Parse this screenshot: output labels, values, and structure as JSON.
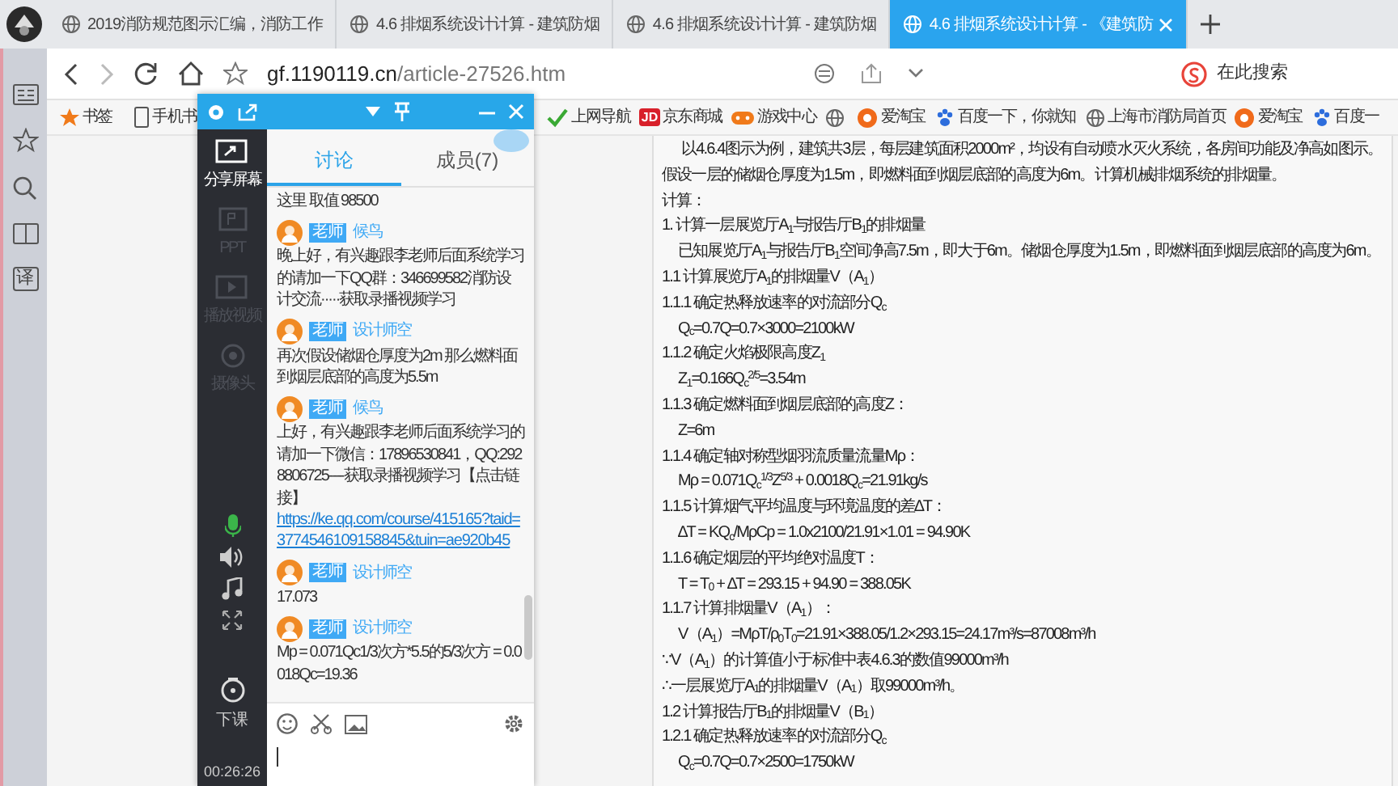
{
  "browser": {
    "tabs": [
      {
        "title": "2019消防规范图示汇编，消防工作",
        "selected": false
      },
      {
        "title": "4.6 排烟系统设计计算 - 建筑防烟",
        "selected": false
      },
      {
        "title": "4.6 排烟系统设计计算 - 建筑防烟",
        "selected": false
      },
      {
        "title": "4.6 排烟系统设计计算 - 《建筑防",
        "selected": true
      }
    ],
    "address_host": "gf.1190119.cn",
    "address_path": "/article-27526.htm",
    "search_placeholder": "在此搜索",
    "bookmarks_left": [
      {
        "label": "书签"
      },
      {
        "label": "手机书"
      }
    ],
    "bookmarks_right": [
      {
        "kind": "link",
        "label": "上网导航"
      },
      {
        "kind": "link",
        "logo_text": "JD",
        "label": "京东商城"
      },
      {
        "kind": "link",
        "label": "游戏中心"
      },
      {
        "kind": "icon"
      },
      {
        "kind": "link",
        "label": "爱淘宝"
      },
      {
        "kind": "link",
        "label": "百度一下，你就知"
      },
      {
        "kind": "link",
        "label": "上海市消防局首页"
      },
      {
        "kind": "link",
        "label": "爱淘宝"
      },
      {
        "kind": "link",
        "label": "百度一"
      }
    ],
    "side_translate": "译"
  },
  "chat": {
    "tools": [
      {
        "label": "分享屏幕",
        "disabled": false
      },
      {
        "label": "PPT",
        "disabled": true
      },
      {
        "label": "播放视频",
        "disabled": true
      },
      {
        "label": "摄像头",
        "disabled": true
      }
    ],
    "mic_on": true,
    "end_label": "下课",
    "timer": "00:26:26",
    "tabs": [
      {
        "label": "讨论",
        "selected": true
      },
      {
        "label": "成员(7)",
        "selected": false
      }
    ],
    "messages": [
      {
        "kind": "text",
        "text": "这里 取值 98500"
      },
      {
        "kind": "post",
        "role": "老师",
        "author": "候鸟",
        "text": "晚上好，有兴趣跟李老师后面系统学习的请加一下QQ群：346699582消防设计交流·····获取录播视频学习"
      },
      {
        "kind": "post",
        "role": "老师",
        "author": "设计师空",
        "text": "再次假设储烟仓厚度为2m  那么燃料面到烟层底部的高度为5.5m"
      },
      {
        "kind": "post",
        "role": "老师",
        "author": "候鸟",
        "text": "上好，有兴趣跟李老师后面系统学习的请加一下微信：17896530841，QQ:2928806725----获取录播视频学习【点击链接】",
        "link": "https://ke.qq.com/course/415165?taid=3774546109158845&tuin=ae920b45"
      },
      {
        "kind": "post",
        "role": "老师",
        "author": "设计师空",
        "text": "17.073"
      },
      {
        "kind": "post",
        "role": "老师",
        "author": "设计师空",
        "text": " Mp = 0.071Qc1/3次方*5.5的5/3次方 = 0.0018Qc=19.36"
      }
    ]
  },
  "article": {
    "lines": [
      {
        "kind": "para",
        "text": "以4.6.4图示为例，建筑共3层，每层建筑面积2000m²，均设有自动喷水灭火系统，各房间功能及净高如图示。假设一层的储烟仓厚度为1.5m，即燃料面到烟层底部的高度为6m。计算机械排烟系统的排烟量。"
      },
      {
        "kind": "plain",
        "text": "计算："
      },
      {
        "kind": "plain",
        "text": "1. 计算一层展览厅A$_{1}$与报告厅B$_{1}$的排烟量"
      },
      {
        "kind": "indent",
        "text": "已知展览厅A$_{1}$与报告厅B$_{1}$空间净高7.5m，即大于6m。储烟仓厚度为1.5m，即燃料面到烟层底部的高度为6m。"
      },
      {
        "kind": "plain",
        "text": "1.1 计算展览厅A$_{1}$的排烟量V（A$_{1}$）"
      },
      {
        "kind": "plain",
        "text": "1.1.1 确定热释放速率的对流部分Q$_{c}$"
      },
      {
        "kind": "indent",
        "text": "Q$_{c}$=0.7Q=0.7×3000=2100kW"
      },
      {
        "kind": "plain",
        "text": "1.1.2 确定火焰极限高度Z$_{1}$"
      },
      {
        "kind": "indent",
        "text": "Z$_{1}$=0.166Q$_{c}$$^{2/5}$=3.54m"
      },
      {
        "kind": "plain",
        "text": "1.1.3 确定燃料面到烟层底部的高度Z："
      },
      {
        "kind": "indent",
        "text": "Z=6m"
      },
      {
        "kind": "plain",
        "text": "1.1.4 确定轴对称型烟羽流质量流量Mρ："
      },
      {
        "kind": "indent",
        "text": "Mρ = 0.071Q$_{c}$$^{1/3}$Z$^{5/3}$ + 0.0018Q$_{c}$=21.91kg/s"
      },
      {
        "kind": "plain",
        "text": "1.1.5 计算烟气平均温度与环境温度的差∆T："
      },
      {
        "kind": "indent",
        "text": "∆T = KQ$_{c}$/MρCp = 1.0x2100/21.91×1.01 = 94.90K"
      },
      {
        "kind": "plain",
        "text": "1.1.6 确定烟层的平均绝对温度T："
      },
      {
        "kind": "indent",
        "text": "T = T$_{0}$ + ∆T = 293.15 + 94.90 = 388.05K"
      },
      {
        "kind": "plain",
        "text": "1.1.7 计算排烟量V（A$_{1}$）："
      },
      {
        "kind": "indent",
        "text": "V（A$_{1}$）=MρT/ρ$_{0}$T$_{0}$=21.91×388.05/1.2×293.15=24.17m³/s=87008m³/h"
      },
      {
        "kind": "plain",
        "text": "∵V（A$_{1}$）的计算值小于标准中表4.6.3的数值99000m³/h"
      },
      {
        "kind": "plain",
        "text": "∴一层展览厅A$_{1}$的排烟量V（A$_{1}$）取99000m³/h。"
      },
      {
        "kind": "plain",
        "text": "1.2 计算报告厅B$_{1}$的排烟量V（B$_{1}$）"
      },
      {
        "kind": "plain",
        "text": "1.2.1 确定热释放速率的对流部分Q$_{c}$"
      },
      {
        "kind": "indent",
        "text": "Q$_{c}$=0.7Q=0.7×2500=1750kW"
      }
    ]
  }
}
